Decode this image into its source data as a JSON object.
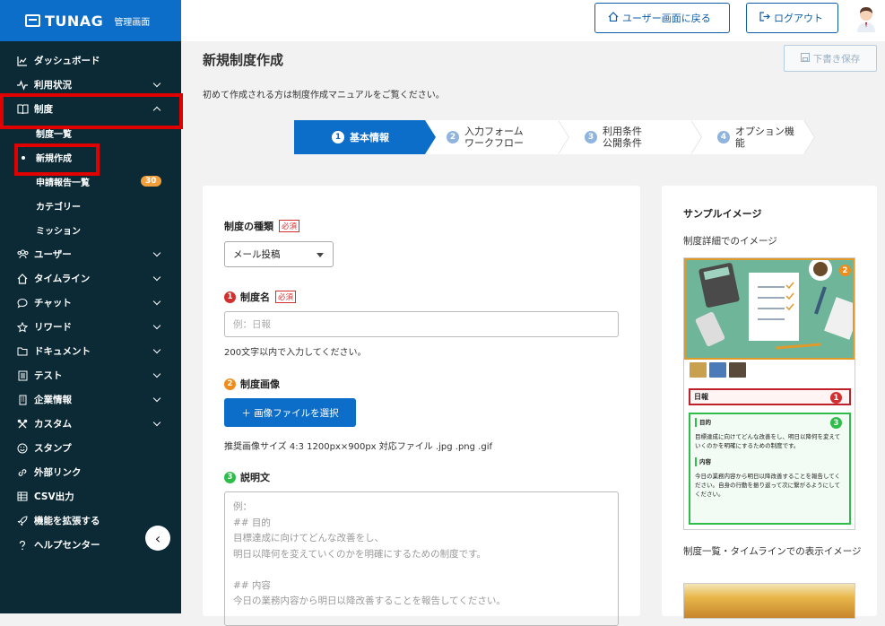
{
  "brand": {
    "name": "TUNAG",
    "sub": "管理画面"
  },
  "header": {
    "back_label": "ユーザー画面に戻る",
    "logout_label": "ログアウト"
  },
  "sidebar": {
    "items": [
      {
        "label": "ダッシュボード",
        "icon": "chart-icon"
      },
      {
        "label": "利用状況",
        "icon": "pulse-icon"
      },
      {
        "label": "制度",
        "icon": "book-icon"
      },
      {
        "label": "ユーザー",
        "icon": "users-icon"
      },
      {
        "label": "タイムライン",
        "icon": "home-icon"
      },
      {
        "label": "チャット",
        "icon": "chat-icon"
      },
      {
        "label": "リワード",
        "icon": "star-icon"
      },
      {
        "label": "ドキュメント",
        "icon": "folder-icon"
      },
      {
        "label": "テスト",
        "icon": "list-icon"
      },
      {
        "label": "企業情報",
        "icon": "building-icon"
      },
      {
        "label": "カスタム",
        "icon": "tools-icon"
      },
      {
        "label": "スタンプ",
        "icon": "smile-icon"
      },
      {
        "label": "外部リンク",
        "icon": "link-icon"
      },
      {
        "label": "CSV出力",
        "icon": "table-icon"
      },
      {
        "label": "機能を拡張する",
        "icon": "rocket-icon"
      },
      {
        "label": "ヘルプセンター",
        "icon": "question-icon"
      }
    ],
    "sub_items": [
      {
        "label": "制度一覧"
      },
      {
        "label": "新規作成"
      },
      {
        "label": "申請報告一覧",
        "badge": "30"
      },
      {
        "label": "カテゴリー"
      },
      {
        "label": "ミッション"
      }
    ]
  },
  "main": {
    "title": "新規制度作成",
    "draft_label": "下書き保存",
    "intro": "初めて作成される方は制度作成マニュアルをご覧ください。",
    "steps": [
      {
        "num": "1",
        "line1": "基本情報",
        "line2": ""
      },
      {
        "num": "2",
        "line1": "入力フォーム",
        "line2": "ワークフロー"
      },
      {
        "num": "3",
        "line1": "利用条件",
        "line2": "公開条件"
      },
      {
        "num": "4",
        "line1": "オプション機能",
        "line2": ""
      }
    ]
  },
  "form": {
    "type_label": "制度の種類",
    "required": "必須",
    "type_value": "メール投稿",
    "name_num": "1",
    "name_label": "制度名",
    "name_placeholder": "例：日報",
    "name_hint": "200文字以内で入力してください。",
    "image_num": "2",
    "image_label": "制度画像",
    "upload_label": "＋ 画像ファイルを選択",
    "image_hint": "推奨画像サイズ 4:3 1200px×900px 対応ファイル .jpg .png .gif",
    "desc_num": "3",
    "desc_label": "説明文",
    "desc_placeholder_lines": [
      "例：",
      "## 目的",
      "目標達成に向けてどんな改善をし、",
      "明日以降何を変えていくのかを明確にするための制度です。",
      "",
      "## 内容",
      "今日の業務内容から明日以降改善することを報告してください。"
    ]
  },
  "sample": {
    "title": "サンプルイメージ",
    "detail_label": "制度詳細でのイメージ",
    "preview_name": "日報",
    "preview_purpose_title": "目的",
    "preview_purpose_text": "目標達成に向けてどんな改善をし、明日以降何を変えていくのかを明確にするための制度です。",
    "preview_content_title": "内容",
    "preview_content_text": "今日の業務内容から明日以降改善することを報告してください。自身の行動を振り返って次に繋がるようにしてください。",
    "list_label": "制度一覧・タイムラインでの表示イメージ",
    "marker_1": "1",
    "marker_2": "2",
    "marker_3": "3"
  },
  "colors": {
    "brand": "#0c6ec9",
    "sidebar": "#0b2a36",
    "highlight": "#e00000",
    "badge": "#f3a03c"
  }
}
